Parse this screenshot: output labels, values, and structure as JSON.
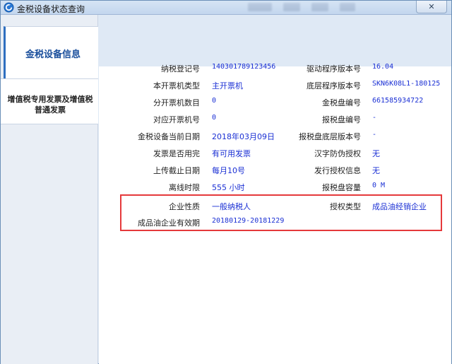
{
  "window": {
    "title": "金税设备状态查询",
    "close_glyph": "✕"
  },
  "nav": {
    "active_label": "金税设备信息",
    "item_label": "增值税专用发票及增值税普通发票"
  },
  "info": {
    "left": [
      {
        "label": "纳税登记号",
        "value": "140301789123456"
      },
      {
        "label": "本开票机类型",
        "value": "主开票机"
      },
      {
        "label": "分开票机数目",
        "value": "0"
      },
      {
        "label": "对应开票机号",
        "value": "0"
      },
      {
        "label": "金税设备当前日期",
        "value": "2018年03月09日"
      },
      {
        "label": "发票是否用完",
        "value": "有可用发票"
      },
      {
        "label": "上传截止日期",
        "value": "每月10号"
      },
      {
        "label": "离线时限",
        "value": "555 小时"
      }
    ],
    "right": [
      {
        "label": "驱动程序版本号",
        "value": "16.04"
      },
      {
        "label": "底层程序版本号",
        "value": "SKN6K08L1-180125"
      },
      {
        "label": "金税盘编号",
        "value": "661585934722"
      },
      {
        "label": "报税盘编号",
        "value": "-"
      },
      {
        "label": "报税盘底层版本号",
        "value": "-"
      },
      {
        "label": "汉字防伪授权",
        "value": "无"
      },
      {
        "label": "发行授权信息",
        "value": "无"
      },
      {
        "label": "报税盘容量",
        "value": "0 M"
      }
    ],
    "highlight": {
      "enterprise_type_label": "企业性质",
      "enterprise_type_value": "一般纳税人",
      "auth_type_label": "授权类型",
      "auth_type_value": "成品油经销企业",
      "validity_label": "成品油企业有效期",
      "validity_value": "20180129-20181229"
    }
  },
  "colors": {
    "value_blue": "#1a2fd4",
    "highlight_red": "#e5393b",
    "nav_blue": "#1a4f9c"
  }
}
